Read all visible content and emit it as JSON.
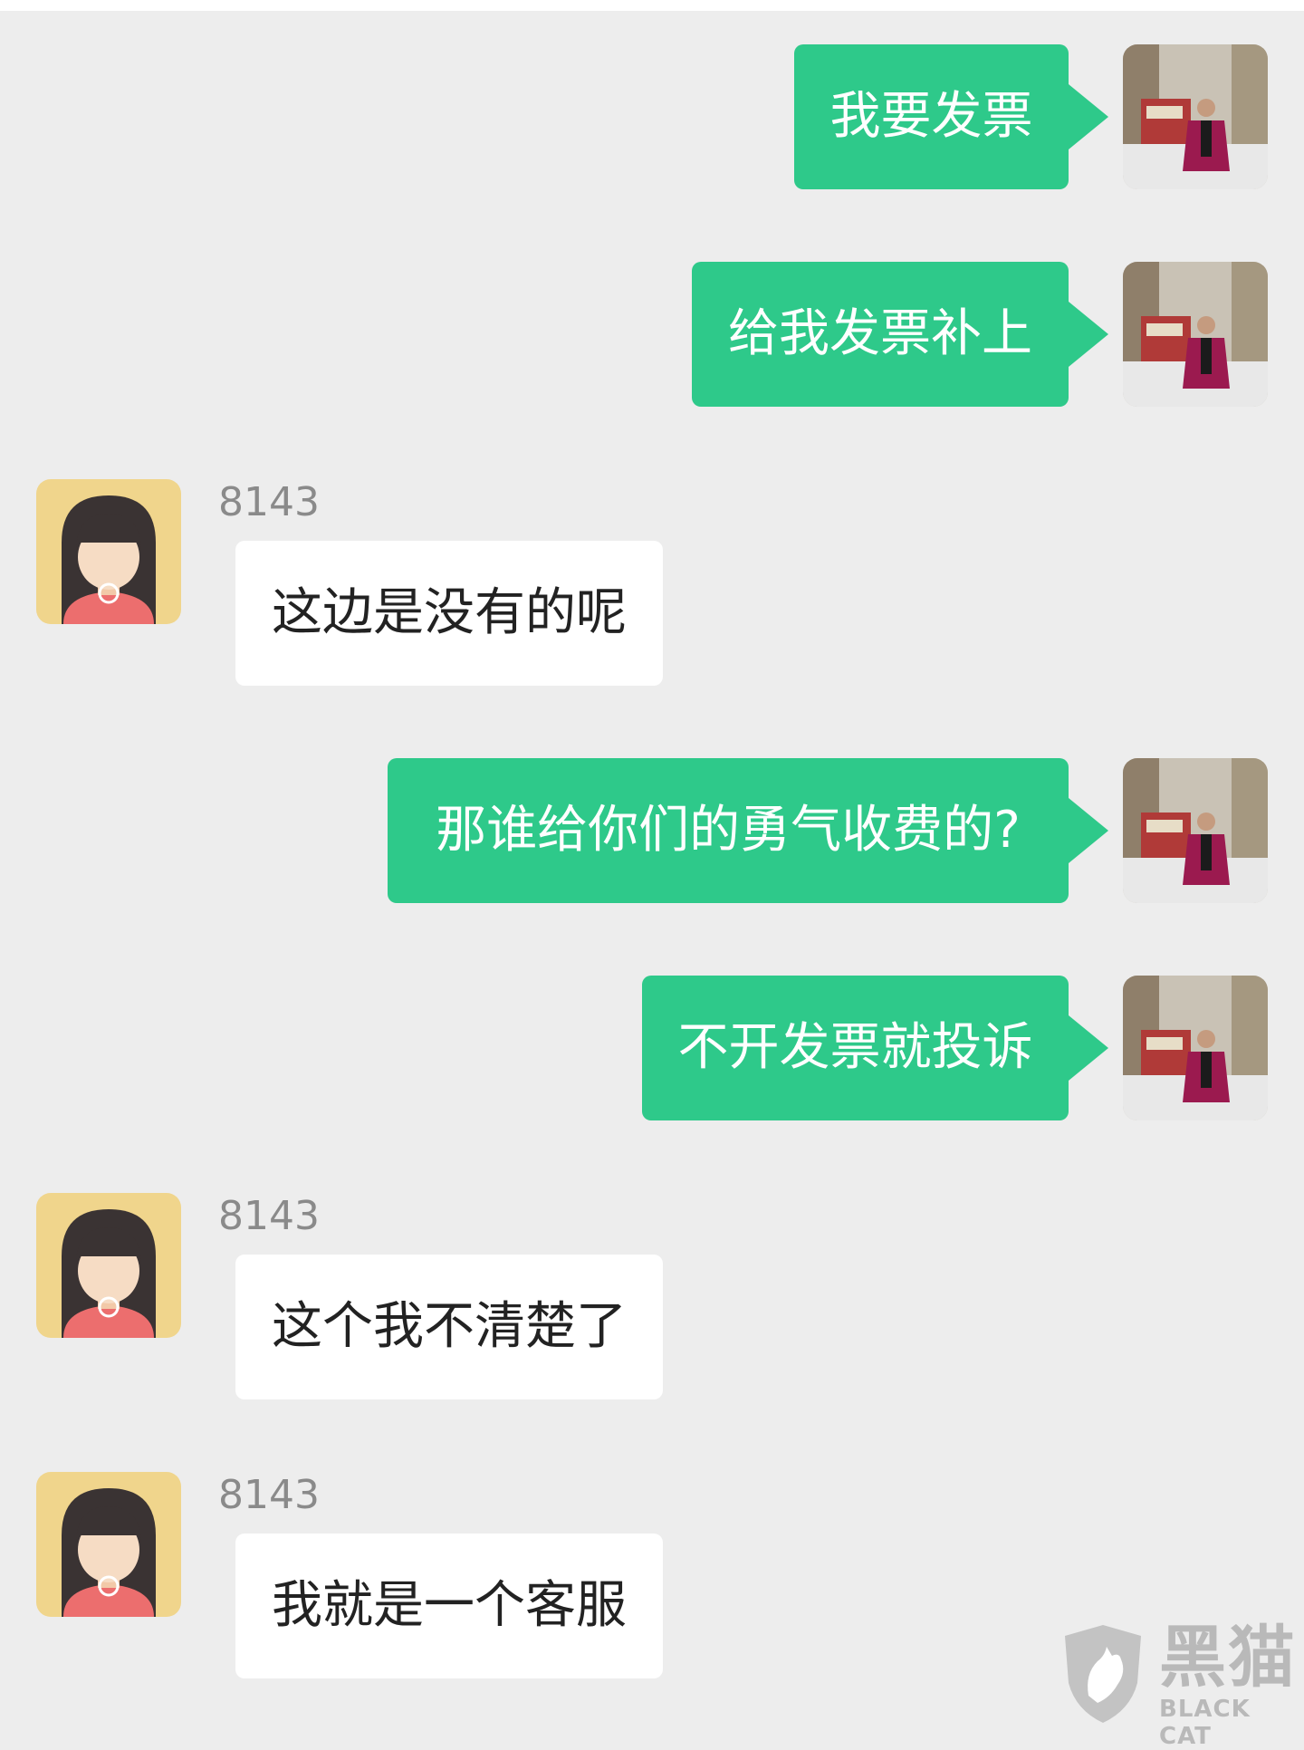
{
  "messages": [
    {
      "side": "out",
      "text": "我要发票"
    },
    {
      "side": "out",
      "text": "给我发票补上"
    },
    {
      "side": "in",
      "sender": "8143",
      "text": "这边是没有的呢"
    },
    {
      "side": "out",
      "text": "那谁给你们的勇气收费的?"
    },
    {
      "side": "out",
      "text": "不开发票就投诉"
    },
    {
      "side": "in",
      "sender": "8143",
      "text": "这个我不清楚了"
    },
    {
      "side": "in",
      "sender": "8143",
      "text": "我就是一个客服"
    }
  ],
  "watermark": {
    "cn": "黑猫",
    "en": "BLACK CAT"
  },
  "colors": {
    "outgoing_bubble": "#2ec98a",
    "incoming_bubble": "#ffffff",
    "background": "#ededed"
  }
}
